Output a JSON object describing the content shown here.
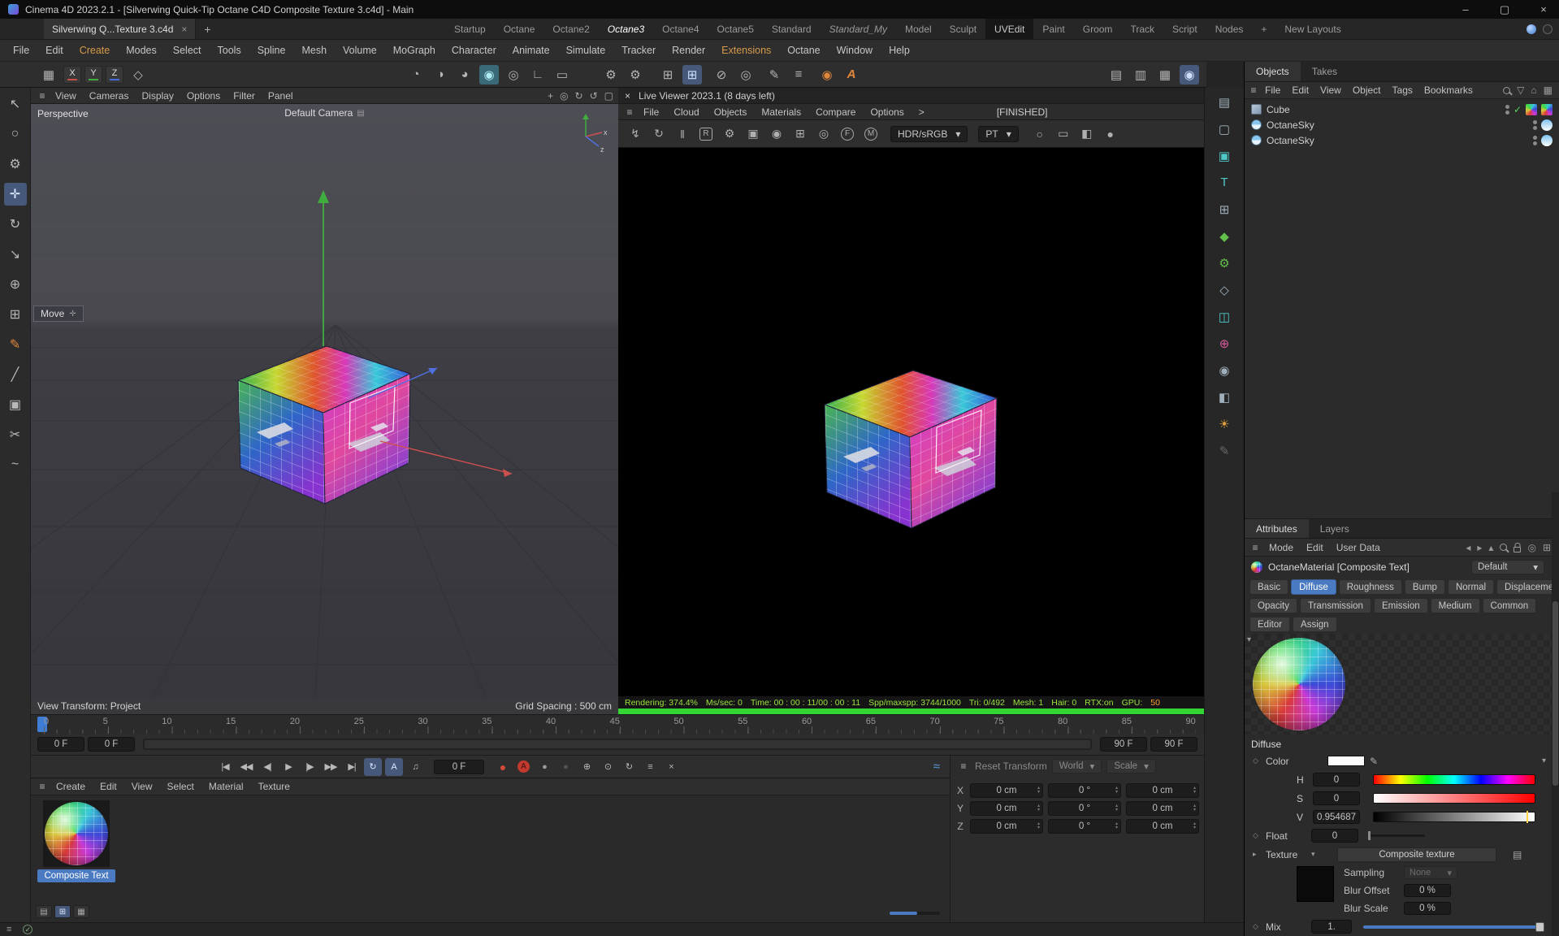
{
  "colors": {
    "accent_blue": "#4a7ac2",
    "octane_orange": "#e0873a",
    "stats_green": "#9be23e",
    "progress_green": "#35d435",
    "axis_x": "#c8504a",
    "axis_y": "#3fae3f",
    "axis_z": "#4a6adf"
  },
  "window": {
    "title": "Cinema 4D 2023.2.1 - [Silverwing Quick-Tip Octane C4D Composite Texture 3.c4d] - Main",
    "minimize": "–",
    "maximize": "▢",
    "close": "×"
  },
  "tabbar": {
    "document_tab": "Silverwing Q...Texture 3.c4d",
    "close": "×",
    "new_tab": "+",
    "layout_tabs": [
      {
        "label": "Startup"
      },
      {
        "label": "Octane"
      },
      {
        "label": "Octane2"
      },
      {
        "label": "Octane3",
        "cls": "active italic"
      },
      {
        "label": "Octane4"
      },
      {
        "label": "Octane5"
      },
      {
        "label": "Standard"
      },
      {
        "label": "Standard_My",
        "cls": "italic"
      },
      {
        "label": "Model"
      },
      {
        "label": "Sculpt"
      },
      {
        "label": "UVEdit",
        "cls": "boxed"
      },
      {
        "label": "Paint"
      },
      {
        "label": "Groom"
      },
      {
        "label": "Track"
      },
      {
        "label": "Script"
      },
      {
        "label": "Nodes"
      },
      {
        "label": "+"
      },
      {
        "label": "New Layouts"
      }
    ]
  },
  "menu_bar": [
    {
      "label": "File"
    },
    {
      "label": "Edit"
    },
    {
      "label": "Create",
      "color": "#d79a4a"
    },
    {
      "label": "Modes"
    },
    {
      "label": "Select"
    },
    {
      "label": "Tools"
    },
    {
      "label": "Spline"
    },
    {
      "label": "Mesh"
    },
    {
      "label": "Volume"
    },
    {
      "label": "MoGraph"
    },
    {
      "label": "Character"
    },
    {
      "label": "Animate"
    },
    {
      "label": "Simulate"
    },
    {
      "label": "Tracker"
    },
    {
      "label": "Render"
    },
    {
      "label": "Extensions",
      "color": "#d79a4a"
    },
    {
      "label": "Octane"
    },
    {
      "label": "Window"
    },
    {
      "label": "Help"
    }
  ],
  "toolbar": {
    "workplane_glyph": "▦",
    "coordplane_glyph": "◇",
    "axis_buttons": [
      {
        "label": "X",
        "cls": "ax-x"
      },
      {
        "label": "Y",
        "cls": "ax-y"
      },
      {
        "label": "Z",
        "cls": "ax-z"
      }
    ],
    "view_icons": [
      {
        "name": "magnet-icon",
        "glyph": "◔"
      },
      {
        "name": "shading-icon",
        "glyph": "◑"
      },
      {
        "name": "display-mode-icon",
        "glyph": "◕"
      },
      {
        "name": "interactive-render-icon",
        "glyph": "◉",
        "cls": "active-teal"
      },
      {
        "name": "wireframe-icon",
        "glyph": "◎"
      },
      {
        "name": "ruler-icon",
        "glyph": "∟"
      },
      {
        "name": "workplane-mode-icon",
        "glyph": "▭"
      }
    ],
    "render_icons": [
      {
        "name": "render-view-icon",
        "glyph": "⚙"
      },
      {
        "name": "render-settings-icon",
        "glyph": "⚙"
      }
    ],
    "snap_icons": [
      {
        "name": "grid-icon",
        "glyph": "⊞"
      },
      {
        "name": "grid-snap-icon",
        "glyph": "⊞",
        "cls": "active-blue"
      }
    ],
    "state_icons": [
      {
        "name": "disable-icon",
        "glyph": "⊘"
      },
      {
        "name": "target-icon",
        "glyph": "◎"
      }
    ],
    "edit_icons": [
      {
        "name": "pen-icon",
        "glyph": "✎"
      },
      {
        "name": "options-icon",
        "glyph": "≡"
      }
    ],
    "octane_icons": [
      {
        "name": "octane-ball-icon",
        "glyph": "◉",
        "color": "#e0873a"
      },
      {
        "name": "octane-a-icon",
        "glyph": "A",
        "color": "#e0873a",
        "cls": "boldA"
      }
    ],
    "layout_icons": [
      {
        "name": "layout-monitor1-icon",
        "glyph": "▤"
      },
      {
        "name": "layout-monitor2-icon",
        "glyph": "▥"
      },
      {
        "name": "layout-monitor3-icon",
        "glyph": "▦"
      },
      {
        "name": "live-viewer-toggle-icon",
        "glyph": "◉",
        "cls": "active-blue"
      }
    ]
  },
  "left_toolbar": [
    {
      "name": "select-tool-icon",
      "glyph": "↖"
    },
    {
      "name": "live-selection-icon",
      "glyph": "○"
    },
    {
      "name": "modeling-settings-icon",
      "glyph": "⚙"
    },
    {
      "name": "move-tool-icon",
      "glyph": "✛",
      "cls": "active"
    },
    {
      "name": "rotate-tool-icon",
      "glyph": "↻"
    },
    {
      "name": "scale-tool-icon",
      "glyph": "↘"
    },
    {
      "name": "axis-tool-icon",
      "glyph": "⊕"
    },
    {
      "name": "coord-system-icon",
      "glyph": "⊞"
    },
    {
      "name": "pen-tool-icon",
      "glyph": "✎",
      "color": "#e0873a"
    },
    {
      "name": "brush-tool-icon",
      "glyph": "╱"
    },
    {
      "name": "clone-tool-icon",
      "glyph": "▣"
    },
    {
      "name": "knife-tool-icon",
      "glyph": "✂"
    },
    {
      "name": "spline-pen-icon",
      "glyph": "~"
    }
  ],
  "viewport": {
    "menus": [
      {
        "label": "View"
      },
      {
        "label": "Cameras"
      },
      {
        "label": "Display"
      },
      {
        "label": "Options"
      },
      {
        "label": "Filter"
      },
      {
        "label": "Panel"
      }
    ],
    "header_icons": [
      {
        "name": "pan-view-icon",
        "glyph": "+"
      },
      {
        "name": "dolly-view-icon",
        "glyph": "◎"
      },
      {
        "name": "rotate-view-icon",
        "glyph": "↻"
      },
      {
        "name": "reset-view-icon",
        "glyph": "↺"
      },
      {
        "name": "toggle-single-view-icon",
        "glyph": "▢"
      }
    ],
    "label": "Perspective",
    "camera_label": "Default Camera",
    "tooltip": "Move",
    "footer_left": "View Transform: Project",
    "footer_right": "Grid Spacing : 500 cm"
  },
  "live_viewer": {
    "close": "×",
    "title": "Live Viewer 2023.1 (8 days left)",
    "menus": [
      {
        "label": "File"
      },
      {
        "label": "Cloud"
      },
      {
        "label": "Objects"
      },
      {
        "label": "Materials"
      },
      {
        "label": "Compare"
      },
      {
        "label": "Options"
      },
      {
        "label": ">"
      }
    ],
    "status": "[FINISHED]",
    "toolbar": [
      {
        "name": "restart-render-icon",
        "glyph": "↯"
      },
      {
        "name": "refresh-icon",
        "glyph": "↻"
      },
      {
        "name": "pause-icon",
        "glyph": "‖"
      },
      {
        "name": "region-render-icon",
        "glyph": "R",
        "cls": "boxl"
      },
      {
        "name": "render-settings-icon",
        "glyph": "⚙"
      },
      {
        "name": "lock-resolution-icon",
        "glyph": "▣"
      },
      {
        "name": "material-ball-icon",
        "glyph": "◉"
      },
      {
        "name": "pip-frame-icon",
        "glyph": "⊞"
      },
      {
        "name": "focus-pick-icon",
        "glyph": "◎"
      },
      {
        "name": "film-settings-icon",
        "glyph": "F",
        "cls": "circl"
      },
      {
        "name": "material-pick-icon",
        "glyph": "M",
        "cls": "circl"
      }
    ],
    "display_dropdown": "HDR/sRGB",
    "kernel_dropdown": "PT",
    "dropdown_caret": "▾",
    "tail_icons": [
      {
        "name": "white-balance-icon",
        "glyph": "○"
      },
      {
        "name": "region-box-icon",
        "glyph": "▭"
      },
      {
        "name": "camera-capture-icon",
        "glyph": "◧"
      },
      {
        "name": "record-dot-icon",
        "glyph": "●"
      }
    ],
    "stats": [
      {
        "label": "Rendering: 374.4%"
      },
      {
        "label": "Ms/sec: 0"
      },
      {
        "label": "Time: 00 : 00 : 11/00 : 00 : 11"
      },
      {
        "label": "Spp/maxspp: 3744/1000"
      },
      {
        "label": "Tri: 0/492"
      },
      {
        "label": "Mesh: 1"
      },
      {
        "label": "Hair: 0"
      },
      {
        "label": "RTX:on"
      },
      {
        "label": "GPU:"
      },
      {
        "label": "50",
        "color": "#ffa02f"
      }
    ]
  },
  "timeline": {
    "numbers": [
      "0",
      "5",
      "10",
      "15",
      "20",
      "25",
      "30",
      "35",
      "40",
      "45",
      "50",
      "55",
      "60",
      "65",
      "70",
      "75",
      "80",
      "85",
      "90"
    ],
    "left_fields": [
      "0 F",
      "0 F"
    ],
    "right_fields": [
      "90 F",
      "90 F"
    ]
  },
  "playbar": {
    "transport": [
      {
        "name": "goto-start-icon",
        "glyph": "|◀"
      },
      {
        "name": "prev-key-icon",
        "glyph": "◀◀"
      },
      {
        "name": "prev-frame-icon",
        "glyph": "◀|"
      },
      {
        "name": "play-icon",
        "glyph": "▶"
      },
      {
        "name": "next-frame-icon",
        "glyph": "|▶"
      },
      {
        "name": "next-key-icon",
        "glyph": "▶▶"
      },
      {
        "name": "goto-end-icon",
        "glyph": "▶|"
      },
      {
        "name": "loop-mode-icon",
        "glyph": "↻",
        "cls": "active-blue"
      },
      {
        "name": "autokey-frame-icon",
        "glyph": "A",
        "cls": "active-blue"
      },
      {
        "name": "sound-icon",
        "glyph": "♫"
      }
    ],
    "frame_field": "0 F",
    "record_icons": [
      {
        "name": "record-icon",
        "glyph": "●",
        "cls": "rec-red"
      },
      {
        "name": "autokey-icon",
        "glyph": "A",
        "cls": "rec-red-circle"
      },
      {
        "name": "keyframe-icon",
        "glyph": "●",
        "color": "#9a9a9a"
      },
      {
        "name": "keyframe-off-icon",
        "glyph": "●",
        "color": "#555555"
      },
      {
        "name": "position-key-icon",
        "glyph": "⊕"
      },
      {
        "name": "scale-key-icon",
        "glyph": "⊙"
      },
      {
        "name": "rotation-key-icon",
        "glyph": "↻"
      },
      {
        "name": "parameter-key-icon",
        "glyph": "≡"
      },
      {
        "name": "pla-key-icon",
        "glyph": "×"
      }
    ],
    "fcurve_icon": "≈"
  },
  "material_manager": {
    "menus": [
      {
        "label": "Create"
      },
      {
        "label": "Edit"
      },
      {
        "label": "View"
      },
      {
        "label": "Select"
      },
      {
        "label": "Material"
      },
      {
        "label": "Texture"
      }
    ],
    "material_name": "Composite Text",
    "view_buttons": [
      {
        "name": "list-view-icon",
        "glyph": "▤"
      },
      {
        "name": "grid-view-icon",
        "glyph": "⊞",
        "cls": "active"
      },
      {
        "name": "icon-view-icon",
        "glyph": "▦"
      }
    ]
  },
  "coordinates": {
    "reset": "Reset Transform",
    "space": "World",
    "scale": "Scale",
    "caret": "▾",
    "rows": [
      {
        "axis": "X",
        "pos": "0 cm",
        "rot": "0 °",
        "scl": "0 cm"
      },
      {
        "axis": "Y",
        "pos": "0 cm",
        "rot": "0 °",
        "scl": "0 cm"
      },
      {
        "axis": "Z",
        "pos": "0 cm",
        "rot": "0 °",
        "scl": "0 cm"
      }
    ]
  },
  "objects_panel": {
    "tabs": [
      {
        "label": "Objects",
        "cls": "active"
      },
      {
        "label": "Takes"
      }
    ],
    "menus": [
      {
        "label": "File"
      },
      {
        "label": "Edit"
      },
      {
        "label": "View"
      },
      {
        "label": "Object"
      },
      {
        "label": "Tags"
      },
      {
        "label": "Bookmarks"
      }
    ],
    "tree": [
      {
        "label": "Cube"
      },
      {
        "label": "OctaneSky"
      },
      {
        "label": "OctaneSky"
      }
    ]
  },
  "attributes_panel": {
    "tabs": [
      {
        "label": "Attributes",
        "cls": "active"
      },
      {
        "label": "Layers"
      }
    ],
    "mode_menus": [
      {
        "label": "Mode"
      },
      {
        "label": "Edit"
      },
      {
        "label": "User Data"
      }
    ],
    "title": "OctaneMaterial [Composite Text]",
    "preset": "Default",
    "preset_caret": "▾",
    "tab_row_1": [
      {
        "label": "Basic"
      },
      {
        "label": "Diffuse",
        "cls": "active"
      },
      {
        "label": "Roughness"
      },
      {
        "label": "Bump"
      },
      {
        "label": "Normal"
      },
      {
        "label": "Displacement"
      }
    ],
    "tab_row_2": [
      {
        "label": "Opacity"
      },
      {
        "label": "Transmission"
      },
      {
        "label": "Emission"
      },
      {
        "label": "Medium"
      },
      {
        "label": "Common"
      }
    ],
    "tab_row_3": [
      {
        "label": "Editor"
      },
      {
        "label": "Assign"
      }
    ],
    "section": "Diffuse",
    "color_label": "Color",
    "h_label": "H",
    "h_value": "0",
    "s_label": "S",
    "s_value": "0",
    "v_label": "V",
    "v_value": "0.954687",
    "float_label": "Float",
    "float_value": "0",
    "texture_label": "Texture",
    "texture_button": "Composite texture",
    "sampling_label": "Sampling",
    "sampling_value": "None",
    "blur_offset_label": "Blur Offset",
    "blur_offset_value": "0 %",
    "blur_scale_label": "Blur Scale",
    "blur_scale_value": "0 %",
    "mix_label": "Mix",
    "mix_value": "1."
  },
  "right_strip": [
    {
      "name": "layer-browser-icon",
      "glyph": "▤"
    },
    {
      "name": "shape-icon",
      "glyph": "▢"
    },
    {
      "name": "volume-cube-icon",
      "glyph": "▣",
      "color": "#4fc8c8"
    },
    {
      "name": "text-tool-icon",
      "glyph": "T",
      "color": "#4fc8c8"
    },
    {
      "name": "uv-grid-icon",
      "glyph": "⊞"
    },
    {
      "name": "plugin-icon",
      "glyph": "◆",
      "color": "#62c04a"
    },
    {
      "name": "green-gear-icon",
      "glyph": "⚙",
      "color": "#62c04a"
    },
    {
      "name": "polygon-icon",
      "glyph": "◇"
    },
    {
      "name": "panel-layout-icon",
      "glyph": "◫",
      "color": "#4fc8c8"
    },
    {
      "name": "axis-cross-icon",
      "glyph": "⊕",
      "color": "#d85a9a"
    },
    {
      "name": "globe-icon",
      "glyph": "◉"
    },
    {
      "name": "display-monitor-icon",
      "glyph": "◧"
    },
    {
      "name": "sun-icon",
      "glyph": "☀",
      "color": "#e0a03a"
    },
    {
      "name": "pencil-dim-icon",
      "glyph": "✎",
      "color": "#6a6a6a"
    }
  ]
}
